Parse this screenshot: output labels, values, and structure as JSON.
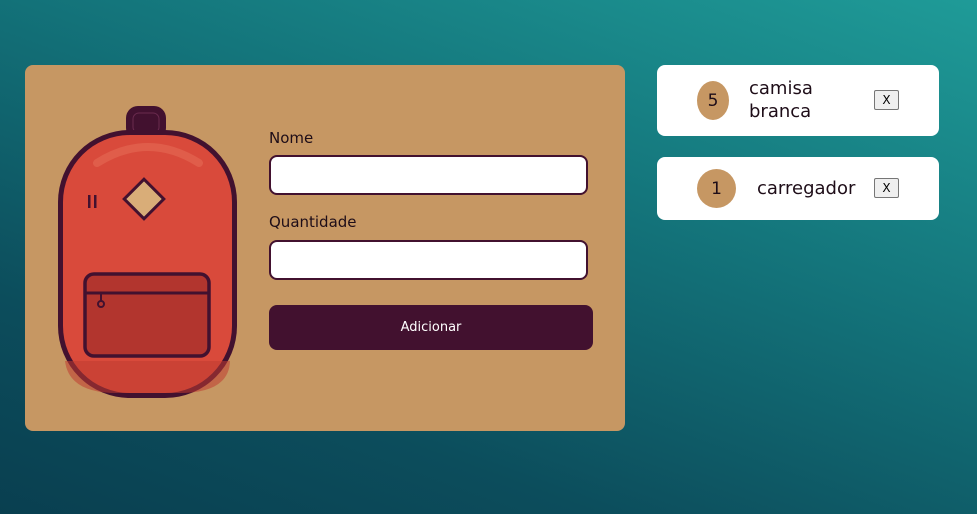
{
  "form": {
    "name_label": "Nome",
    "name_value": "",
    "quantity_label": "Quantidade",
    "quantity_value": "",
    "submit_label": "Adicionar"
  },
  "items": [
    {
      "quantity": "5",
      "name": "camisa branca",
      "remove_label": "X"
    },
    {
      "quantity": "1",
      "name": "carregador",
      "remove_label": "X"
    }
  ],
  "icons": {
    "illustration": "backpack-icon"
  },
  "colors": {
    "card_background": "#c69763",
    "accent_dark": "#42112f",
    "backpack_red": "#d94a3b",
    "list_card_background": "#ffffff"
  }
}
